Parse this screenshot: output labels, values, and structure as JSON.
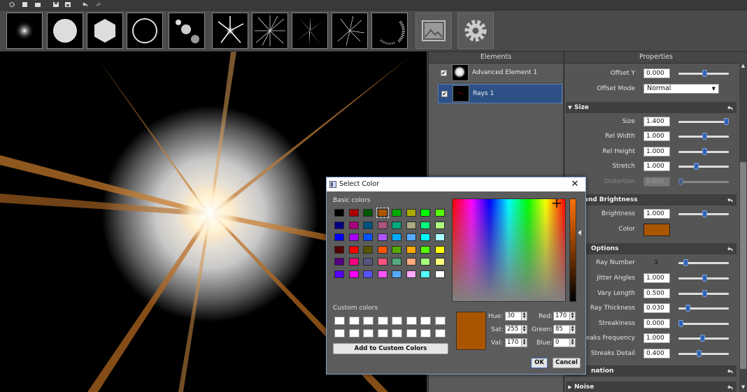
{
  "panels": {
    "elements_title": "Elements",
    "properties_title": "Properties"
  },
  "elements": [
    {
      "label": "Advanced Element 1",
      "checked": true,
      "selected": false
    },
    {
      "label": "Rays 1",
      "checked": true,
      "selected": true
    }
  ],
  "properties": {
    "offset_y": {
      "label": "Offset Y",
      "value": "0.000"
    },
    "offset_mode": {
      "label": "Offset Mode",
      "value": "Normal"
    },
    "size_section": "Size",
    "size": {
      "label": "Size",
      "value": "1.400"
    },
    "rel_width": {
      "label": "Rel Width",
      "value": "1.000"
    },
    "rel_height": {
      "label": "Rel Height",
      "value": "1.000"
    },
    "stretch": {
      "label": "Stretch",
      "value": "1.000"
    },
    "distortion": {
      "label": "Distortion",
      "value": "0.000"
    },
    "color_section": "or and Brightness",
    "brightness": {
      "label": "Brightness",
      "value": "1.000"
    },
    "color": {
      "label": "Color",
      "hex": "#aa5500"
    },
    "options_section": "Options",
    "ray_number": {
      "label": "Ray Number",
      "value": "3"
    },
    "jitter_angles": {
      "label": "Jitter Angles",
      "value": "1.000"
    },
    "vary_length": {
      "label": "Vary Length",
      "value": "0.500"
    },
    "ray_thickness": {
      "label": "Ray Thickness",
      "value": "0.030"
    },
    "streakiness": {
      "label": "Streakiness",
      "value": "0.000"
    },
    "streaks_frequency": {
      "label": "treaks Frequency",
      "value": "1.000"
    },
    "streaks_detail": {
      "label": "Streaks Detail",
      "value": "0.400"
    },
    "animation_section": "nation",
    "noise_section": "Noise"
  },
  "dialog": {
    "title": "Select Color",
    "basic_colors_label": "Basic colors",
    "custom_colors_label": "Custom colors",
    "add_custom_label": "Add to Custom Colors",
    "basic_colors": [
      "#000000",
      "#aa0000",
      "#005500",
      "#aa5500",
      "#00aa00",
      "#aaaa00",
      "#00ff00",
      "#55ff00",
      "#000080",
      "#aa007f",
      "#00557f",
      "#aa557f",
      "#00aa7f",
      "#aaaa7f",
      "#00ff7f",
      "#aaff7f",
      "#0000ff",
      "#aa00ff",
      "#0055ff",
      "#aa55ff",
      "#00aaff",
      "#55aaff",
      "#00ffff",
      "#aaffff",
      "#550000",
      "#ff0000",
      "#555500",
      "#ff5500",
      "#55aa00",
      "#ffaa00",
      "#55ff00",
      "#ffff00",
      "#550080",
      "#ff007f",
      "#55557f",
      "#ff557f",
      "#55aa7f",
      "#ffaa7f",
      "#aaff7f",
      "#ffff7f",
      "#5500ff",
      "#ff00ff",
      "#5555ff",
      "#ff55ff",
      "#55aaff",
      "#ffaaff",
      "#55ffff",
      "#ffffff"
    ],
    "selected_basic_index": 3,
    "current_color": "#aa5500",
    "hue": {
      "label": "Hue:",
      "value": "30"
    },
    "sat": {
      "label": "Sat:",
      "value": "255"
    },
    "val": {
      "label": "Val:",
      "value": "170"
    },
    "red": {
      "label": "Red:",
      "value": "170"
    },
    "green": {
      "label": "Green:",
      "value": "85"
    },
    "blue": {
      "label": "Blue:",
      "value": "0"
    },
    "ok_label": "OK",
    "cancel_label": "Cancel"
  }
}
